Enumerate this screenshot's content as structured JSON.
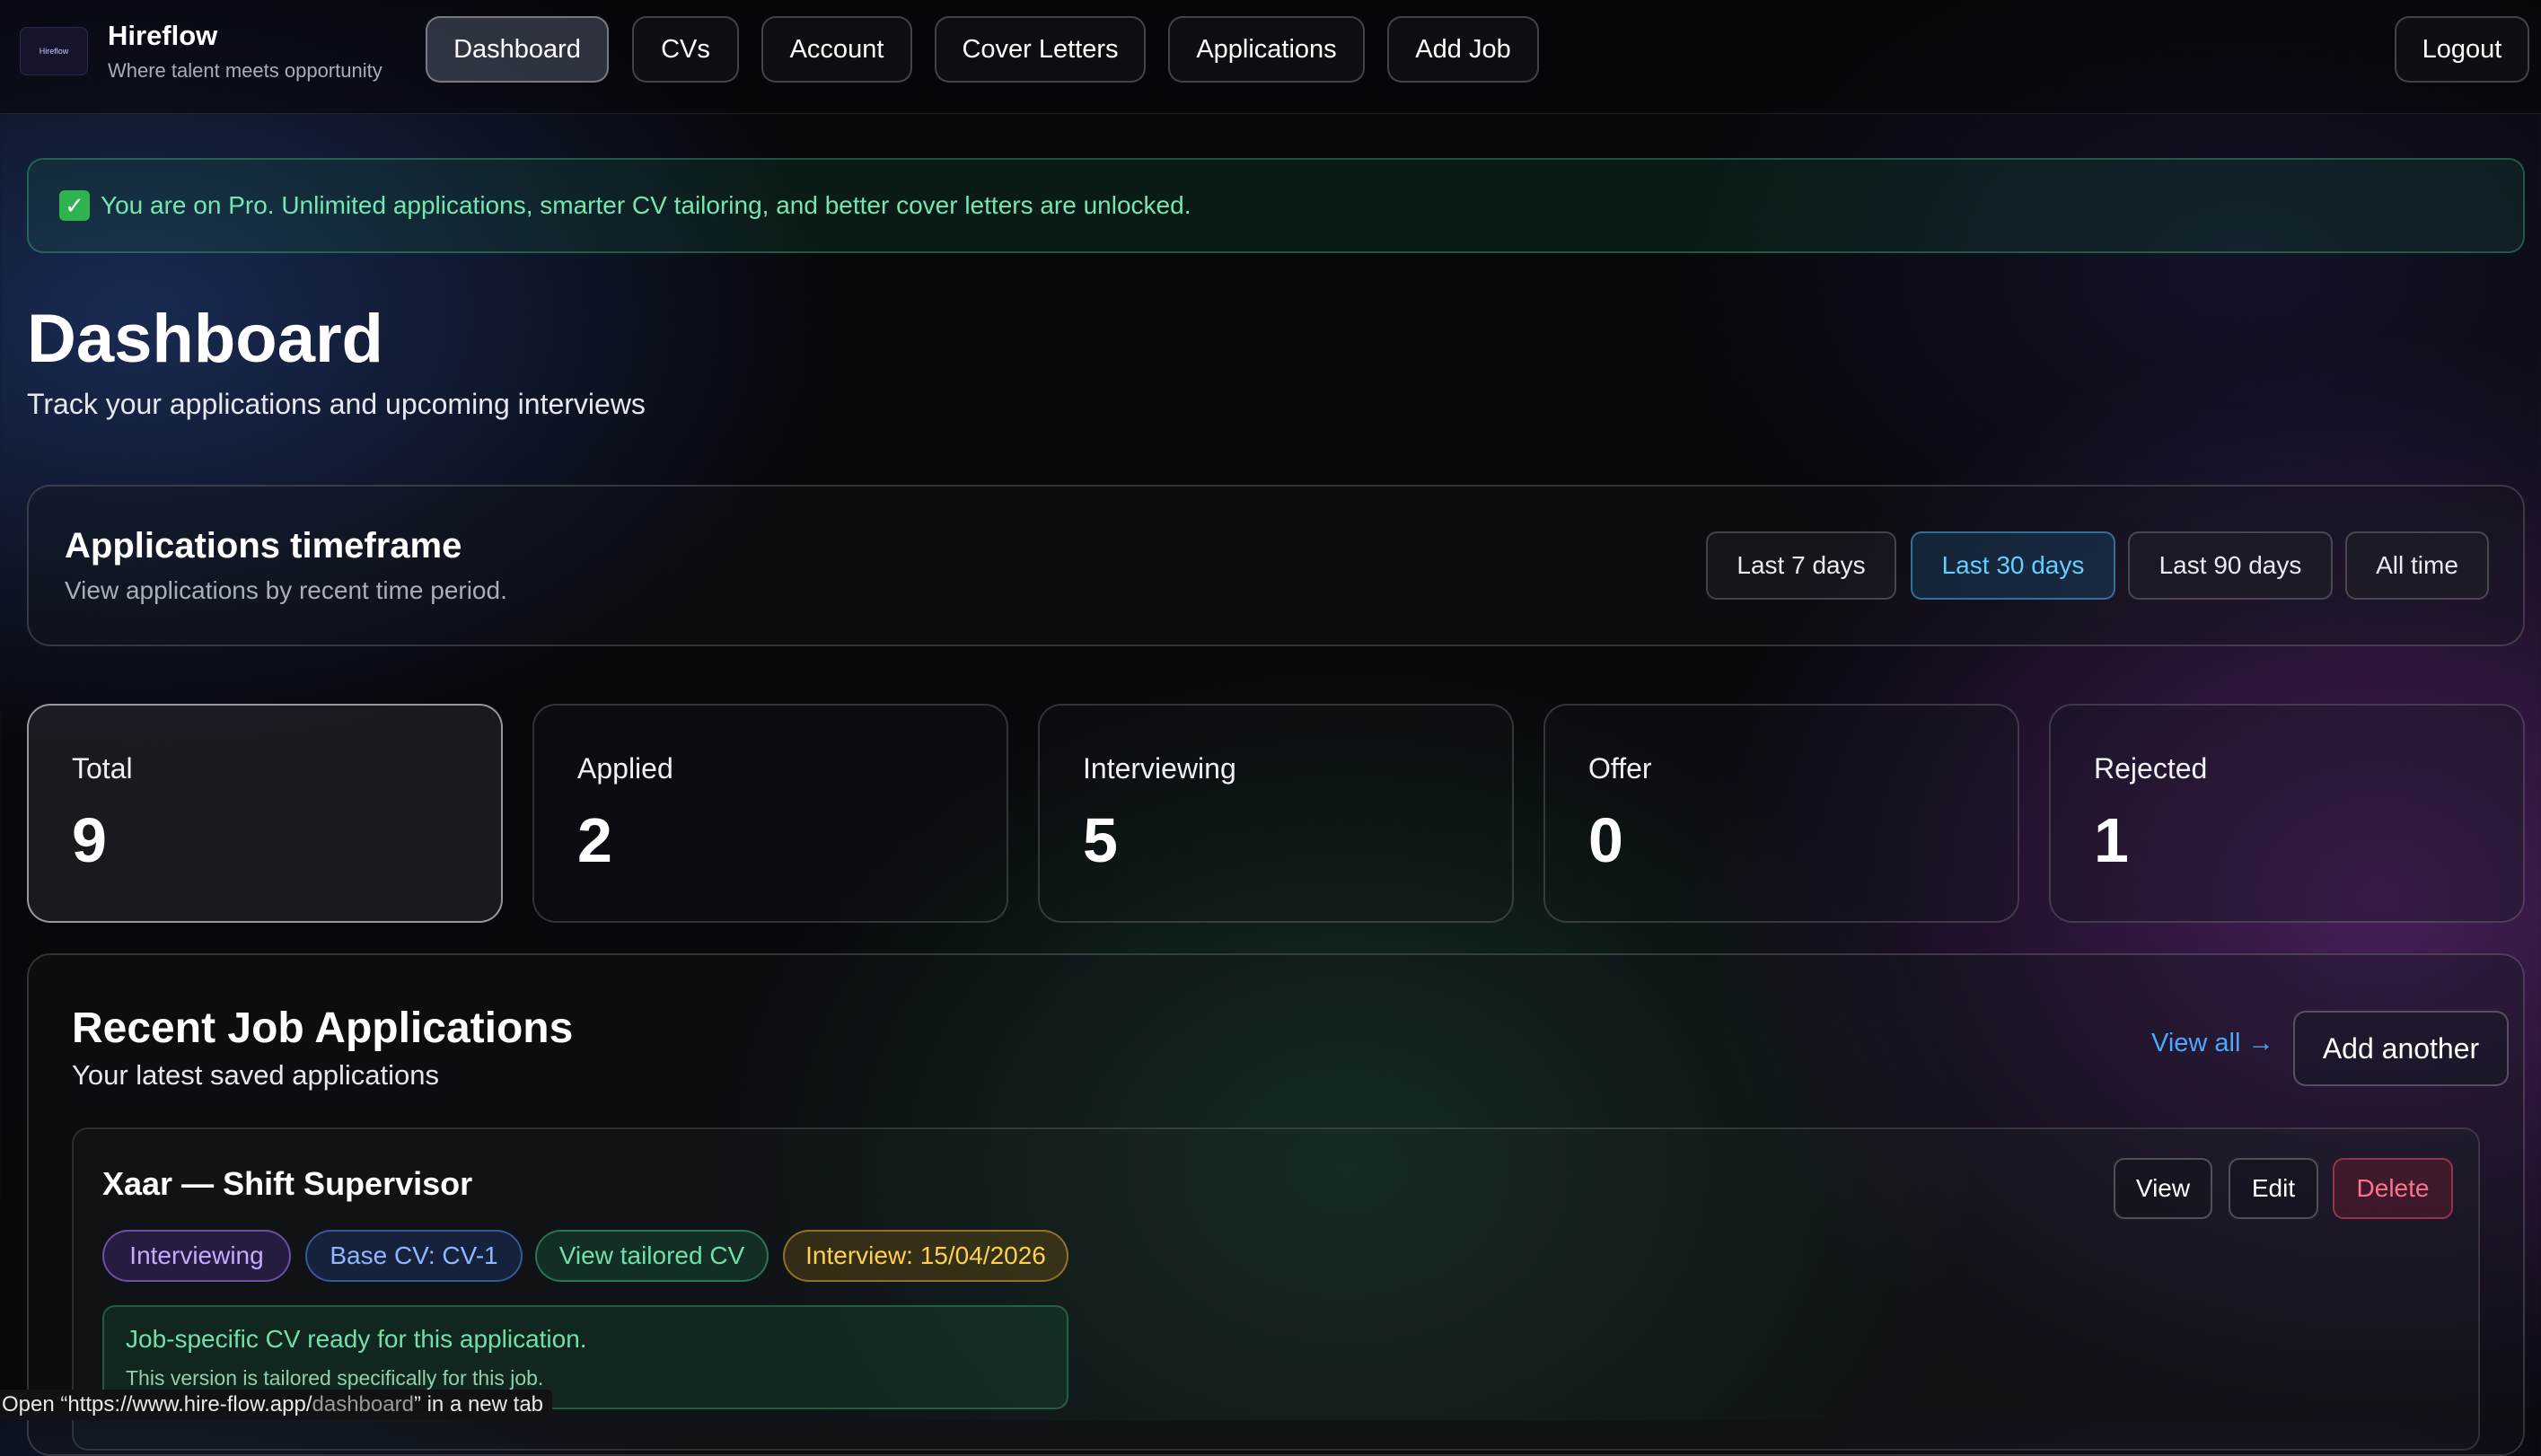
{
  "brand": {
    "title": "Hireflow",
    "tagline": "Where talent meets opportunity",
    "logo_text": "Hireflow"
  },
  "nav": {
    "items": [
      {
        "label": "Dashboard",
        "active": true
      },
      {
        "label": "CVs"
      },
      {
        "label": "Account"
      },
      {
        "label": "Cover Letters"
      },
      {
        "label": "Applications"
      },
      {
        "label": "Add Job"
      }
    ],
    "logout": "Logout"
  },
  "banner": {
    "icon": "check-icon",
    "text": "You are on Pro. Unlimited applications, smarter CV tailoring, and better cover letters are unlocked."
  },
  "page": {
    "title": "Dashboard",
    "subtitle": "Track your applications and upcoming interviews"
  },
  "timeframe": {
    "title": "Applications timeframe",
    "subtitle": "View applications by recent time period.",
    "options": [
      "Last 7 days",
      "Last 30 days",
      "Last 90 days",
      "All time"
    ],
    "selected": "Last 30 days"
  },
  "stats": [
    {
      "label": "Total",
      "value": "9"
    },
    {
      "label": "Applied",
      "value": "2"
    },
    {
      "label": "Interviewing",
      "value": "5"
    },
    {
      "label": "Offer",
      "value": "0"
    },
    {
      "label": "Rejected",
      "value": "1"
    }
  ],
  "recent": {
    "title": "Recent Job Applications",
    "subtitle": "Your latest saved applications",
    "view_all": "View all →",
    "add_another": "Add another",
    "job": {
      "title": "Xaar — Shift Supervisor",
      "actions": {
        "view": "View",
        "edit": "Edit",
        "delete": "Delete"
      },
      "chips": {
        "status": "Interviewing",
        "base_cv": "Base CV: CV-1",
        "tailored": "View tailored CV",
        "interview": "Interview: 15/04/2026"
      },
      "ready_title": "Job-specific CV ready for this application.",
      "ready_sub": "This version is tailored specifically for this job."
    }
  },
  "statusbar": {
    "prefix": "Open “https://www.hire-flow.app/",
    "path": "dashboard",
    "suffix": "” in a new tab"
  },
  "colors": {
    "accent_blue": "#5fd0ff",
    "pro_green": "#74e6ae",
    "danger": "#ff6f8e",
    "interview_yellow": "#ffd04f"
  }
}
